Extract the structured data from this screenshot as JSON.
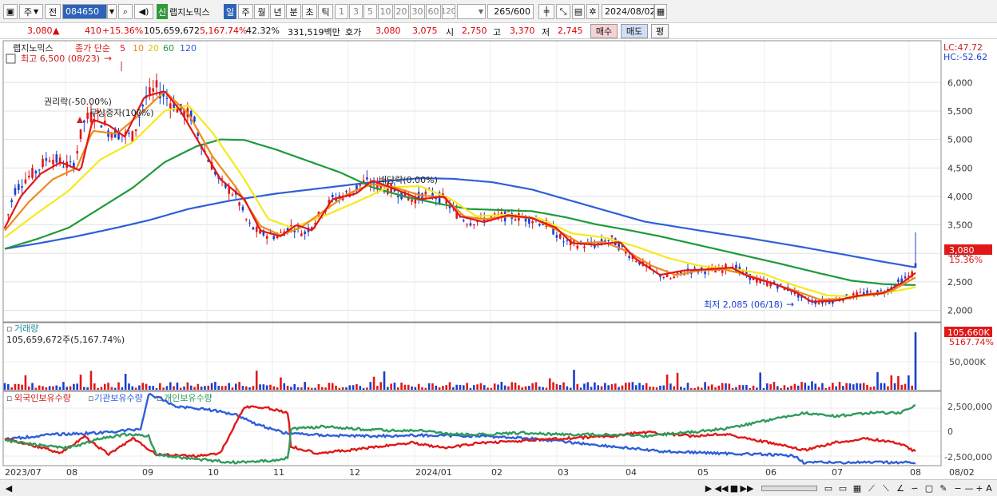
{
  "toolbar": {
    "market": "주",
    "market_type": "전",
    "code": "084650",
    "badge": "신",
    "name": "랩지노믹스",
    "periods": [
      "일",
      "주",
      "월",
      "년",
      "분",
      "초",
      "틱"
    ],
    "intervals": [
      "1",
      "3",
      "5",
      "10",
      "20",
      "30",
      "60",
      "120"
    ],
    "count": "265",
    "count_total": "/600",
    "date": "2024/08/02"
  },
  "quote": {
    "price": "3,080",
    "arrow": "▲",
    "change": "410",
    "change_pct": "+15.36%",
    "volume": "105,659,672",
    "volume_pct": "5,167.74%",
    "turnover_rate": "42.32%",
    "amount": "331,519백만",
    "ask_label": "호가",
    "ask": "3,080",
    "bid": "3,075",
    "open_label": "시",
    "open": "2,750",
    "high_label": "고",
    "high": "3,370",
    "low_label": "저",
    "low": "2,745",
    "buy": "매수",
    "sell": "매도",
    "avg": "평"
  },
  "price_panel": {
    "stock_name": "랩지노믹스",
    "legend_label": "종가 단순",
    "ma_periods": [
      "5",
      "10",
      "20",
      "60",
      "120"
    ],
    "high_note": "최고 6,500 (08/23)",
    "low_note": "최저 2,085 (06/18)",
    "ann_rights": "권리락(-50.00%)",
    "ann_capital": "무상증자(100%)",
    "ann_dividend": "배당락(0.00%)",
    "lc": "LC:47.72",
    "hc": "HC:-52.62",
    "price_tag": "3,080",
    "pct_tag": "15.36%",
    "y_ticks": [
      "6,000",
      "5,500",
      "5,000",
      "4,500",
      "4,000",
      "3,500",
      "3,000",
      "2,500",
      "2,000"
    ]
  },
  "volume_panel": {
    "title": "거래량",
    "value": "105,659,672주(5,167.74%)",
    "tag": "105,660K",
    "tag_pct": "5167.74%",
    "tick": "50,000K"
  },
  "holdings_panel": {
    "legend": [
      "외국인보유수량",
      "기관보유수량",
      "개인보유수량"
    ],
    "ticks": [
      "2,500,000",
      "0",
      "-2,500,000"
    ]
  },
  "x_axis": {
    "labels": [
      "2023/07",
      "08",
      "09",
      "10",
      "11",
      "12",
      "2024/01",
      "02",
      "03",
      "04",
      "05",
      "06",
      "07",
      "08"
    ],
    "right_label": "08/02"
  },
  "colors": {
    "ma5": "#e01818",
    "ma10": "#f08a1c",
    "ma20": "#f4ea1c",
    "ma60": "#1e9a3a",
    "ma120": "#2e5fd8",
    "up": "#e01818",
    "down": "#1a3fd0",
    "holdings_foreign": "#e01818",
    "holdings_inst": "#2e5fd8",
    "holdings_indiv": "#2e9a5a"
  }
}
